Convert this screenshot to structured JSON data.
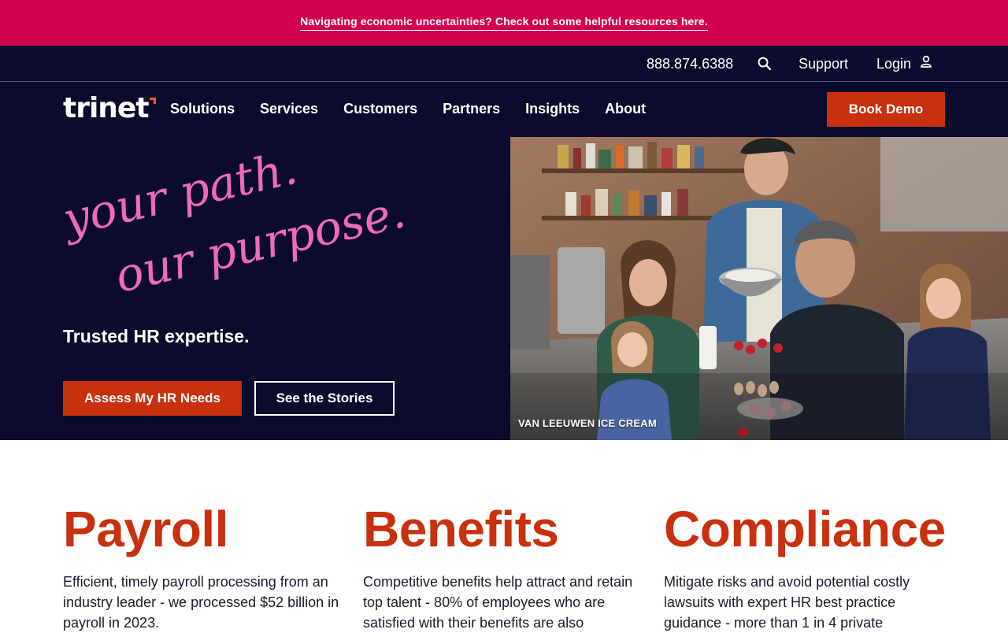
{
  "announcement": {
    "text": "Navigating economic uncertainties? Check out some helpful resources here."
  },
  "utility": {
    "phone": "888.874.6388",
    "support": "Support",
    "login": "Login",
    "search_icon": "search-icon",
    "user_icon": "user-icon"
  },
  "brand": {
    "logo_text": "trinet",
    "accent": "#ff5a2c"
  },
  "nav": {
    "items": [
      "Solutions",
      "Services",
      "Customers",
      "Partners",
      "Insights",
      "About"
    ],
    "cta": "Book Demo"
  },
  "hero": {
    "tagline_line1": "your path.",
    "tagline_line2": "our purpose.",
    "subhead": "Trusted HR expertise.",
    "primary_cta": "Assess My HR Needs",
    "secondary_cta": "See the Stories",
    "photo_caption": "VAN LEEUWEN ICE CREAM"
  },
  "features": [
    {
      "title": "Payroll",
      "body": "Efficient, timely payroll processing from an industry leader - we processed $52 billion in payroll in 2023."
    },
    {
      "title": "Benefits",
      "body": "Competitive benefits help attract and retain top talent - 80% of employees who are satisfied with their benefits are also"
    },
    {
      "title": "Compliance",
      "body": "Mitigate risks and avoid potential costly lawsuits with expert HR best practice guidance - more than 1 in 4 private"
    }
  ],
  "colors": {
    "banner": "#d1004f",
    "navy": "#0b0b2e",
    "orange": "#c8300e",
    "pink": "#f06ab4"
  }
}
